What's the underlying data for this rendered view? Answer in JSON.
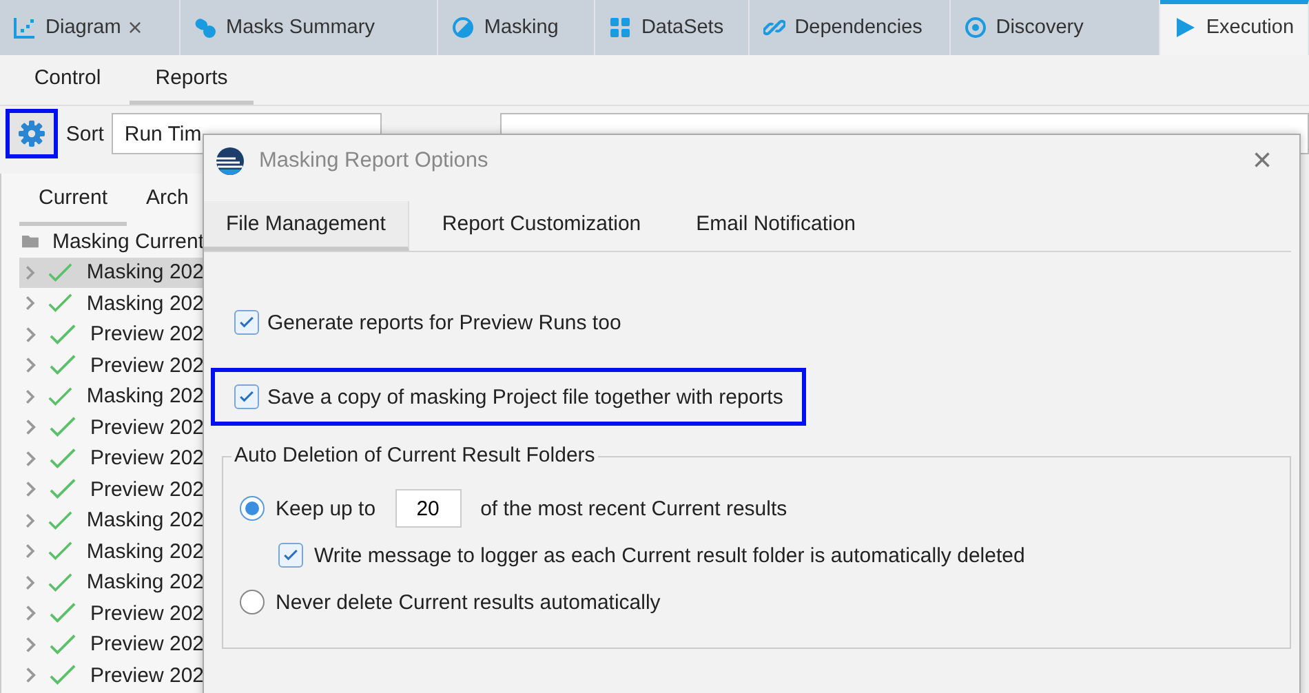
{
  "tabs": [
    {
      "label": "Diagram",
      "kind": "diagram",
      "selected": false,
      "closable": true
    },
    {
      "label": "Masks Summary",
      "kind": "pills",
      "selected": false,
      "closable": false
    },
    {
      "label": "Masking",
      "kind": "halfcircle",
      "selected": false,
      "closable": false
    },
    {
      "label": "DataSets",
      "kind": "grid",
      "selected": false,
      "closable": false
    },
    {
      "label": "Dependencies",
      "kind": "link",
      "selected": false,
      "closable": false
    },
    {
      "label": "Discovery",
      "kind": "target",
      "selected": false,
      "closable": false
    },
    {
      "label": "Execution",
      "kind": "play",
      "selected": true,
      "closable": false
    }
  ],
  "close_glyph": "×",
  "subtabs": [
    {
      "label": "Control",
      "selected": false
    },
    {
      "label": "Reports",
      "selected": true
    }
  ],
  "toolbar": {
    "settings_highlighted": true,
    "sort_label": "Sort",
    "sort_value": "Run Tim"
  },
  "result_tabs": [
    {
      "label": "Current",
      "selected": true
    },
    {
      "label": "Arch",
      "selected": false
    }
  ],
  "tree": {
    "label": "Masking Current",
    "children": [
      {
        "label": "Masking 202",
        "selected": true
      },
      {
        "label": "Masking 202",
        "selected": false
      },
      {
        "label": "Preview 202",
        "selected": false
      },
      {
        "label": "Preview 202",
        "selected": false
      },
      {
        "label": "Masking 202",
        "selected": false
      },
      {
        "label": "Preview 202",
        "selected": false
      },
      {
        "label": "Preview 202",
        "selected": false
      },
      {
        "label": "Preview 202",
        "selected": false
      },
      {
        "label": "Masking 202",
        "selected": false
      },
      {
        "label": "Masking 202",
        "selected": false
      },
      {
        "label": "Masking 202",
        "selected": false
      },
      {
        "label": "Preview 202",
        "selected": false
      },
      {
        "label": "Preview 202",
        "selected": false
      },
      {
        "label": "Preview 202",
        "selected": false
      }
    ]
  },
  "dialog": {
    "title": "Masking Report Options",
    "close_glyph": "×",
    "tabs": [
      {
        "label": "File Management",
        "selected": true
      },
      {
        "label": "Report Customization",
        "selected": false
      },
      {
        "label": "Email Notification",
        "selected": false
      }
    ],
    "options": [
      {
        "label": "Generate reports for Preview Runs too",
        "checked": true,
        "highlighted": false
      },
      {
        "label": "Save a copy of masking Project file together with reports",
        "checked": true,
        "highlighted": true
      }
    ],
    "group": {
      "title": "Auto Deletion of Current Result Folders",
      "keep": {
        "selected": true,
        "label": "Keep up to",
        "value": "20",
        "suffix": "of the most recent Current results"
      },
      "log": {
        "label": "Write message to logger as each Current result folder is automatically deleted",
        "checked": true
      },
      "never": {
        "selected": false,
        "label": "Never delete Current results automatically"
      }
    }
  }
}
